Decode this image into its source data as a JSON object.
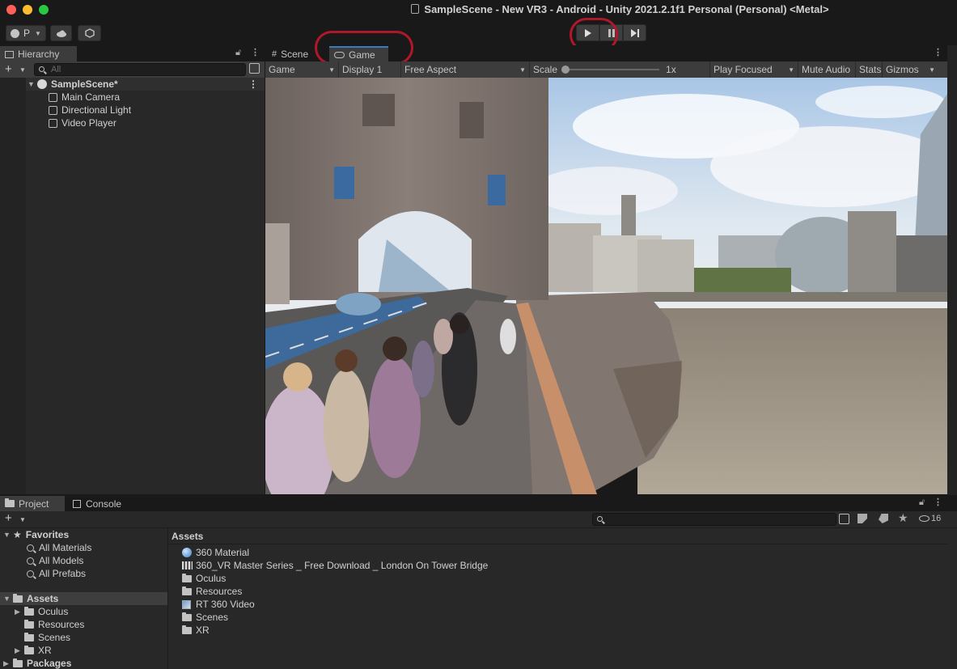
{
  "window": {
    "title": "SampleScene - New VR3 - Android - Unity 2021.2.1f1 Personal (Personal) <Metal>"
  },
  "toolbar": {
    "account_label": "P",
    "play_icon": "play-icon",
    "pause_icon": "pause-icon",
    "step_icon": "step-icon"
  },
  "hierarchy": {
    "tab_label": "Hierarchy",
    "search_placeholder": "All",
    "scene_name": "SampleScene*",
    "items": [
      {
        "label": "Main Camera"
      },
      {
        "label": "Directional Light"
      },
      {
        "label": "Video Player"
      }
    ]
  },
  "view_tabs": {
    "scene": "Scene",
    "game": "Game"
  },
  "game_toolbar": {
    "mode": "Game",
    "display": "Display 1",
    "aspect": "Free Aspect",
    "scale_label": "Scale",
    "scale_value": "1x",
    "play_mode": "Play Focused",
    "mute": "Mute Audio",
    "stats": "Stats",
    "gizmos": "Gizmos"
  },
  "bottom_tabs": {
    "project": "Project",
    "console": "Console"
  },
  "project": {
    "hidden_count": "16",
    "favorites_label": "Favorites",
    "favorites": [
      {
        "label": "All Materials"
      },
      {
        "label": "All Models"
      },
      {
        "label": "All Prefabs"
      }
    ],
    "assets_label": "Assets",
    "asset_folders": [
      {
        "label": "Oculus"
      },
      {
        "label": "Resources"
      },
      {
        "label": "Scenes"
      },
      {
        "label": "XR"
      }
    ],
    "packages_label": "Packages",
    "content_header": "Assets",
    "content": [
      {
        "label": "360 Material"
      },
      {
        "label": "360_VR Master Series _ Free Download _ London On Tower Bridge"
      },
      {
        "label": "Oculus"
      },
      {
        "label": "Resources"
      },
      {
        "label": "RT 360 Video"
      },
      {
        "label": "Scenes"
      },
      {
        "label": "XR"
      }
    ]
  },
  "colors": {
    "highlight_ring": "#b0182a",
    "panel_bg": "#282828",
    "titlebar_bg": "#191919"
  }
}
